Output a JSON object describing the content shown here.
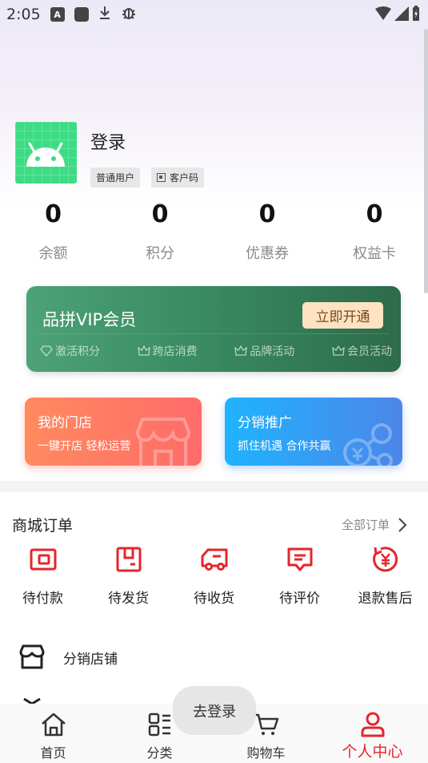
{
  "status_bar": {
    "time": "2:05",
    "notif_a": "A"
  },
  "profile": {
    "name": "登录",
    "tag_user": "普通用户",
    "tag_qr": "客户码"
  },
  "stats": [
    {
      "value": "0",
      "label": "余额"
    },
    {
      "value": "0",
      "label": "积分"
    },
    {
      "value": "0",
      "label": "优惠券"
    },
    {
      "value": "0",
      "label": "权益卡"
    }
  ],
  "vip": {
    "title": "品拼VIP会员",
    "button": "立即开通",
    "perks": [
      "激活积分",
      "跨店消费",
      "品牌活动",
      "会员活动"
    ]
  },
  "promos": {
    "store": {
      "title": "我的门店",
      "subtitle": "一键开店 轻松运营"
    },
    "distribution": {
      "title": "分销推广",
      "subtitle": "抓住机遇 合作共赢"
    }
  },
  "orders": {
    "title": "商城订单",
    "all_label": "全部订单",
    "items": [
      {
        "label": "待付款",
        "icon": "wallet-icon"
      },
      {
        "label": "待发货",
        "icon": "box-icon"
      },
      {
        "label": "待收货",
        "icon": "truck-icon"
      },
      {
        "label": "待评价",
        "icon": "comment-icon"
      },
      {
        "label": "退款售后",
        "icon": "refund-icon"
      }
    ]
  },
  "menu": {
    "distribution_store": "分销店铺"
  },
  "toast": "去登录",
  "tabs": [
    {
      "label": "首页",
      "icon": "home-icon"
    },
    {
      "label": "分类",
      "icon": "category-icon"
    },
    {
      "label": "购物车",
      "icon": "cart-icon"
    },
    {
      "label": "个人中心",
      "icon": "user-icon"
    }
  ],
  "colors": {
    "accent_red": "#e5262b",
    "vip_green": "#3a8b62",
    "promo_orange": "#ff7a62",
    "promo_blue": "#2f9cf5"
  }
}
